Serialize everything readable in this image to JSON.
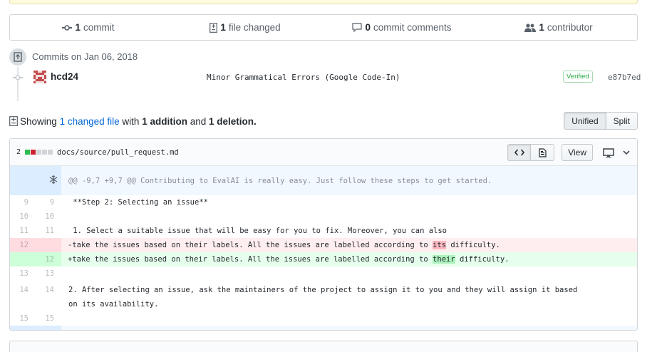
{
  "summary": {
    "commits_count": "1",
    "commits_label": "commit",
    "files_count": "1",
    "files_label": "file changed",
    "comments_count": "0",
    "comments_label": "commit comments",
    "contributors_count": "1",
    "contributors_label": "contributor"
  },
  "commits": {
    "group_title": "Commits on Jan 06, 2018",
    "author": "hcd24",
    "message": "Minor Grammatical Errors (Google Code-In)",
    "verified": "Verified",
    "sha": "e87b7ed"
  },
  "toc": {
    "showing": "Showing",
    "changed_file": "1 changed file",
    "with": "with",
    "additions": "1 addition",
    "and": "and",
    "deletions": "1 deletion.",
    "unified": "Unified",
    "split": "Split"
  },
  "file": {
    "change_count": "2",
    "path": "docs/source/pull_request.md",
    "view_label": "View",
    "hunk_header": "@@ -9,7 +9,7 @@ Contributing to EvalAI is really easy. Just follow these steps to get started.",
    "lines": [
      {
        "old": "9",
        "new": "9",
        "text": " **Step 2: Selecting an issue**"
      },
      {
        "old": "10",
        "new": "10",
        "text": ""
      },
      {
        "old": "11",
        "new": "11",
        "text": " 1. Select a suitable issue that will be easy for you to fix. Moreover, you can also"
      },
      {
        "old": "12",
        "new": "",
        "pre": "-take the issues based on their labels. All the issues are labelled according to ",
        "hl": "its",
        "post": " difficulty."
      },
      {
        "old": "",
        "new": "12",
        "pre": "+take the issues based on their labels. All the issues are labelled according to ",
        "hl": "their",
        "post": " difficulty."
      },
      {
        "old": "13",
        "new": "13",
        "text": ""
      },
      {
        "old": "14",
        "new": "14",
        "text": " 2. After selecting an issue, ask the maintainers of the project to assign it to you and they will assign it based on its availability."
      },
      {
        "old": "15",
        "new": "15",
        "text": ""
      }
    ]
  },
  "colors": {
    "link": "#0366d6",
    "added": "#28a745",
    "deleted": "#cb2431"
  }
}
